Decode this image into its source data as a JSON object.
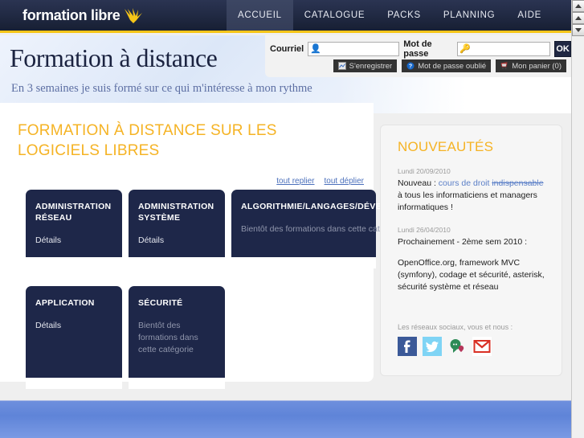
{
  "colors": {
    "navy": "#1e2749",
    "yellow": "#f5c518",
    "heading_orange": "#f5b324",
    "link_blue": "#5b7fc7",
    "footer_blue": "#6e8fdd"
  },
  "topbar": {
    "logo_text": "formation libre",
    "logo_icon": "bird-wing-icon",
    "nav": [
      {
        "label": "ACCUEIL",
        "active": true
      },
      {
        "label": "CATALOGUE",
        "active": false
      },
      {
        "label": "PACKS",
        "active": false
      },
      {
        "label": "PLANNING",
        "active": false
      },
      {
        "label": "AIDE",
        "active": false
      }
    ]
  },
  "banner": {
    "title": "Formation à distance",
    "subtitle": "En 3 semaines je suis formé sur ce qui m'intéresse à mon rythme"
  },
  "login": {
    "email_label": "Courriel",
    "email_value": "",
    "email_icon": "user-icon",
    "password_label": "Mot de passe",
    "password_value": "",
    "password_icon": "key-icon",
    "submit_label": "OK",
    "actions": [
      {
        "label": "S'enregistrer",
        "icon": "register-icon"
      },
      {
        "label": "Mot de passe oublié",
        "icon": "question-mark-icon"
      },
      {
        "label": "Mon panier (0)",
        "icon": "shopping-cart-icon"
      }
    ]
  },
  "main": {
    "heading": "FORMATION À DISTANCE SUR LES LOGICIELS LIBRES",
    "collapse_all_label": "tout replier",
    "expand_all_label": "tout déplier",
    "cards": [
      {
        "title": "ADMINISTRATION RÉSEAU",
        "body": "Détails",
        "muted": false
      },
      {
        "title": "ADMINISTRATION SYSTÈME",
        "body": "Détails",
        "muted": false
      },
      {
        "title": "ALGORITHMIE/LANGAGES/DÉVELOPPEMENT",
        "body": "Bientôt des formations dans cette catégorie",
        "muted": true
      },
      {
        "title": "APPLICATION",
        "body": "Détails",
        "muted": false
      },
      {
        "title": "SÉCURITÉ",
        "body": "Bientôt des formations dans cette catégorie",
        "muted": true
      }
    ]
  },
  "news": {
    "title": "NOUVEAUTÉS",
    "items": [
      {
        "date": "Lundi 20/09/2010",
        "prefix": "Nouveau : ",
        "link": "cours de droit",
        "link2": "indispensable",
        "suffix": " à tous les informaticiens et managers informatiques !"
      },
      {
        "date": "Lundi 26/04/2010",
        "line1": "Prochainement - 2ème sem 2010 :",
        "line2": "OpenOffice.org, framework MVC (symfony), codage et sécurité, asterisk, sécurité système et réseau"
      }
    ],
    "social_label": "Les réseaux sociaux, vous et nous :",
    "social": [
      {
        "name": "facebook-icon"
      },
      {
        "name": "twitter-icon"
      },
      {
        "name": "chat-bubble-icon"
      },
      {
        "name": "gmail-icon"
      }
    ]
  },
  "scrollbar": {
    "up_icon": "scroll-up-arrow-icon",
    "thumb": "scrollbar-thumb",
    "down_icon": "scroll-down-arrow-icon"
  }
}
